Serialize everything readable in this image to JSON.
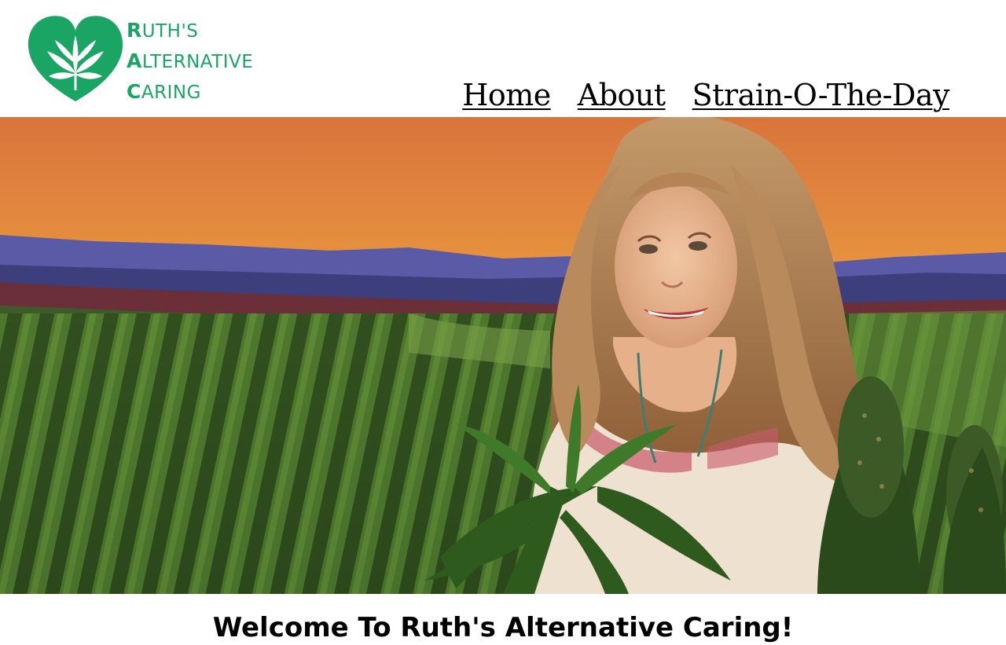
{
  "brand": {
    "lines": [
      {
        "initial": "R",
        "rest": "UTH'S"
      },
      {
        "initial": "A",
        "rest": "LTERNATIVE"
      },
      {
        "initial": "C",
        "rest": "ARING"
      }
    ],
    "color": "#1aa564",
    "icon": "heart-cannabis-leaf-icon"
  },
  "nav": {
    "home": "Home",
    "about": "About",
    "strain": "Strain-O-The-Day"
  },
  "hero": {
    "image": "banner-painting-woman-in-cannabis-field-at-sunset"
  },
  "main": {
    "heading": "Welcome To Ruth's Alternative Caring!"
  }
}
